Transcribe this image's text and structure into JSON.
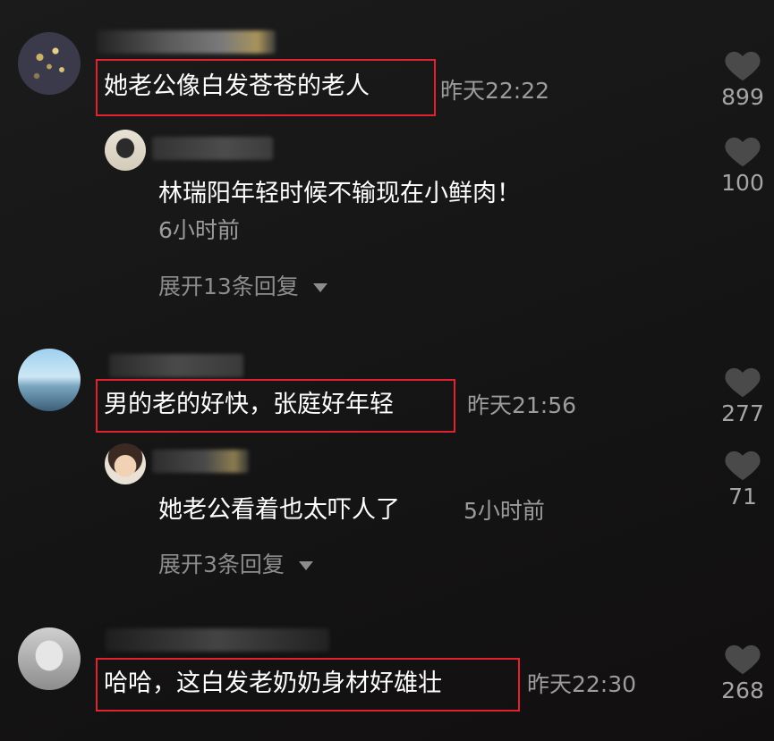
{
  "comments": [
    {
      "text": "她老公像白发苍苍的老人",
      "time": "昨天22:22",
      "likes": "899",
      "reply": {
        "text": "林瑞阳年轻时候不输现在小鲜肉！",
        "time": "6小时前",
        "likes": "100"
      },
      "expand": "展开13条回复"
    },
    {
      "text": "男的老的好快，张庭好年轻",
      "time": "昨天21:56",
      "likes": "277",
      "reply": {
        "text": "她老公看着也太吓人了",
        "time": "5小时前",
        "likes": "71"
      },
      "expand": "展开3条回复"
    },
    {
      "text": "哈哈，这白发老奶奶身材好雄壮",
      "time": "昨天22:30",
      "likes": "268"
    }
  ],
  "icons": {
    "like": "heart-icon",
    "expand": "triangle-down-icon"
  },
  "colors": {
    "highlight_box": "#e3212f",
    "background": "#161616",
    "text": "#ffffff",
    "muted": "#9c9c9c"
  }
}
